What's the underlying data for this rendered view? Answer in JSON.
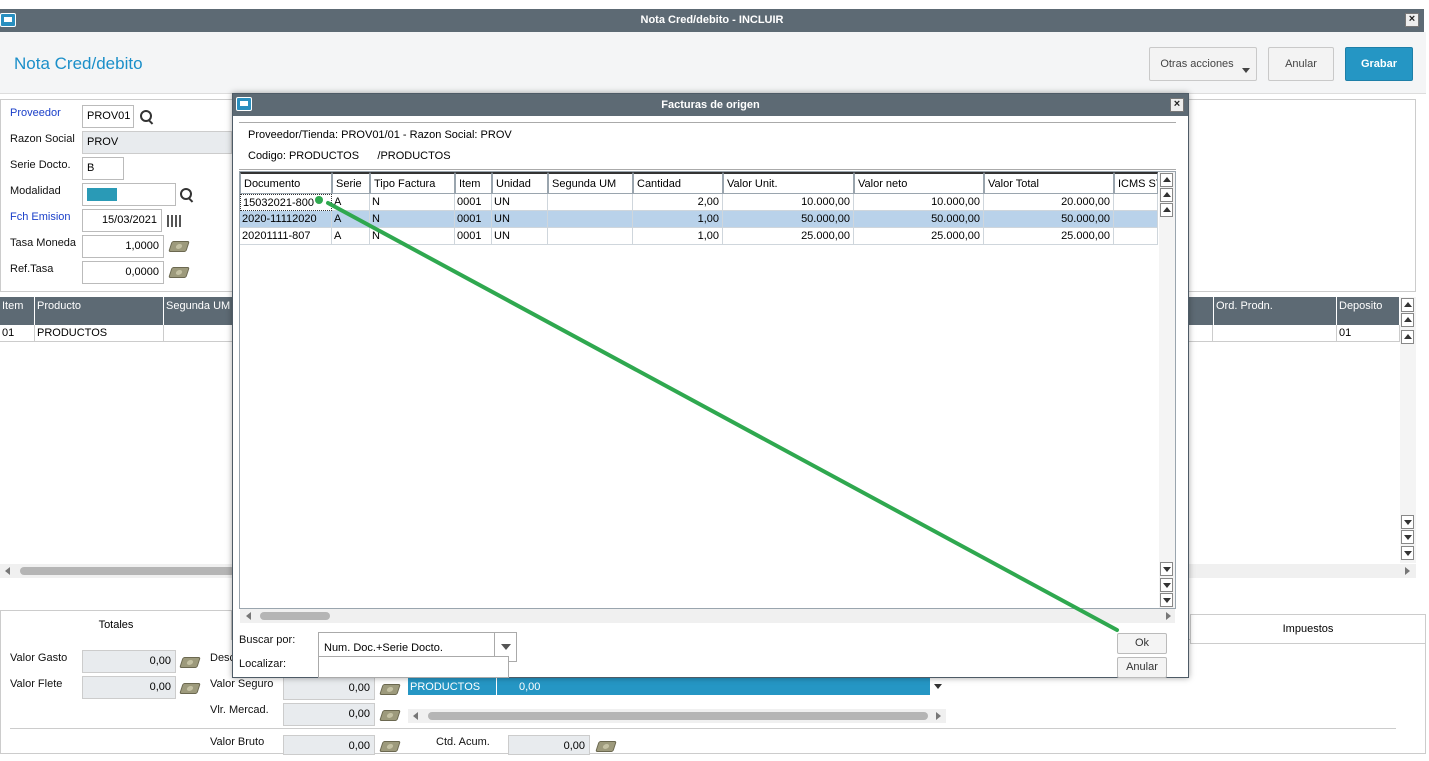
{
  "window": {
    "title": "Nota Cred/debito - INCLUIR",
    "close": "×"
  },
  "header": {
    "title": "Nota Cred/debito",
    "actions": {
      "otras": "Otras acciones",
      "anular": "Anular",
      "grabar": "Grabar"
    }
  },
  "form": {
    "proveedor": {
      "label": "Proveedor",
      "value": "PROV01"
    },
    "razon_social": {
      "label": "Razon Social",
      "value": "PROV"
    },
    "serie_docto": {
      "label": "Serie Docto.",
      "value": "B"
    },
    "modalidad": {
      "label": "Modalidad",
      "value": ""
    },
    "fch_emision": {
      "label": "Fch Emision",
      "value": "15/03/2021"
    },
    "tasa_moneda": {
      "label": "Tasa Moneda",
      "value": "1,0000"
    },
    "ref_tasa": {
      "label": "Ref.Tasa",
      "value": "0,0000"
    }
  },
  "items_grid": {
    "headers": {
      "item": "Item",
      "producto": "Producto",
      "segunda_um": "Segunda UM",
      "ord_prodn": "Ord. Prodn.",
      "deposito": "Deposito"
    },
    "row": {
      "item": "01",
      "producto": "PRODUCTOS",
      "deposito": "01"
    }
  },
  "tabs": {
    "totales": "Totales",
    "impuestos": "Impuestos"
  },
  "totals": {
    "valor_gasto": {
      "label": "Valor Gasto",
      "value": "0,00"
    },
    "valor_flete": {
      "label": "Valor Flete",
      "value": "0,00"
    },
    "desc_label": "Desc",
    "valor_seguro": {
      "label": "Valor Seguro",
      "value": "0,00"
    },
    "vlr_mercad": {
      "label": "Vlr. Mercad.",
      "value": "0,00"
    },
    "valor_bruto": {
      "label": "Valor Bruto",
      "value": "0,00"
    },
    "ctd_acum": {
      "label": "Ctd. Acum.",
      "value": "0,00"
    },
    "mini_row": {
      "producto": "PRODUCTOS",
      "valor": "0,00"
    }
  },
  "modal": {
    "title": "Facturas de origen",
    "info_line1": "Proveedor/Tienda: PROV01/01  -  Razon Social: PROV",
    "info_line2": "Codigo: PRODUCTOS      /PRODUCTOS",
    "columns": [
      "Documento",
      "Serie",
      "Tipo Factura",
      "Item",
      "Unidad",
      "Segunda UM",
      "Cantidad",
      "Valor Unit.",
      "Valor neto",
      "Valor Total",
      "ICMS ST"
    ],
    "rows": [
      {
        "documento": "15032021-800",
        "serie": "A",
        "tipo": "N",
        "item": "0001",
        "unidad": "UN",
        "segunda_um": "",
        "cantidad": "2,00",
        "valor_unit": "10.000,00",
        "valor_neto": "10.000,00",
        "valor_total": "20.000,00",
        "icms_st": ""
      },
      {
        "documento": "2020-11112020",
        "serie": "A",
        "tipo": "N",
        "item": "0001",
        "unidad": "UN",
        "segunda_um": "",
        "cantidad": "1,00",
        "valor_unit": "50.000,00",
        "valor_neto": "50.000,00",
        "valor_total": "50.000,00",
        "icms_st": ""
      },
      {
        "documento": "20201111-807",
        "serie": "A",
        "tipo": "N",
        "item": "0001",
        "unidad": "UN",
        "segunda_um": "",
        "cantidad": "1,00",
        "valor_unit": "25.000,00",
        "valor_neto": "25.000,00",
        "valor_total": "25.000,00",
        "icms_st": ""
      }
    ],
    "selected_row": 1,
    "buscar_label": "Buscar por:",
    "buscar_value": "Num. Doc.+Serie Docto.",
    "localizar_label": "Localizar:",
    "localizar_value": "",
    "ok": "Ok",
    "anular": "Anular"
  },
  "colors": {
    "titlebar": "#5d6a74",
    "accent": "#2596c4",
    "link_label": "#1a3fc9",
    "annotation": "#2fa84f"
  }
}
